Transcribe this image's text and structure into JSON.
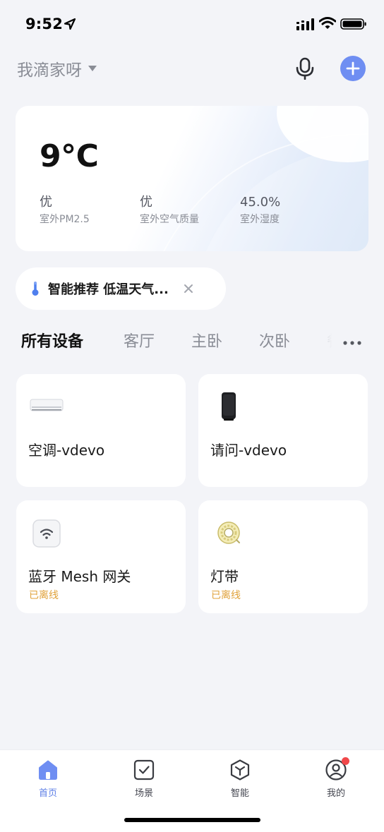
{
  "status_bar": {
    "time": "9:52"
  },
  "header": {
    "home_name": "我滴家呀"
  },
  "weather": {
    "temperature": "9°C",
    "metrics": [
      {
        "value": "优",
        "label": "室外PM2.5"
      },
      {
        "value": "优",
        "label": "室外空气质量"
      },
      {
        "value": "45.0%",
        "label": "室外湿度"
      }
    ]
  },
  "recommendation": {
    "text": "智能推荐 低温天气..."
  },
  "rooms": {
    "tabs": [
      {
        "label": "所有设备",
        "active": true
      },
      {
        "label": "客厅",
        "active": false
      },
      {
        "label": "主卧",
        "active": false
      },
      {
        "label": "次卧",
        "active": false
      },
      {
        "label": "餐",
        "active": false
      }
    ]
  },
  "devices": [
    {
      "name": "空调-vdevo",
      "status": "",
      "icon": "air-conditioner-icon"
    },
    {
      "name": "请问-vdevo",
      "status": "",
      "icon": "smart-speaker-icon"
    },
    {
      "name": "蓝牙 Mesh 网关",
      "status": "已离线",
      "icon": "mesh-gateway-icon"
    },
    {
      "name": "灯带",
      "status": "已离线",
      "icon": "light-strip-icon"
    }
  ],
  "bottom_nav": {
    "items": [
      {
        "label": "首页",
        "icon": "home-icon",
        "active": true
      },
      {
        "label": "场景",
        "icon": "scene-icon",
        "active": false
      },
      {
        "label": "智能",
        "icon": "smart-icon",
        "active": false
      },
      {
        "label": "我的",
        "icon": "profile-icon",
        "active": false
      }
    ]
  },
  "colors": {
    "accent": "#6F8EF2",
    "active_tab": "#5E7FE6",
    "offline": "#E0A23A",
    "background": "#F3F4F8",
    "notification": "#F0484A"
  }
}
